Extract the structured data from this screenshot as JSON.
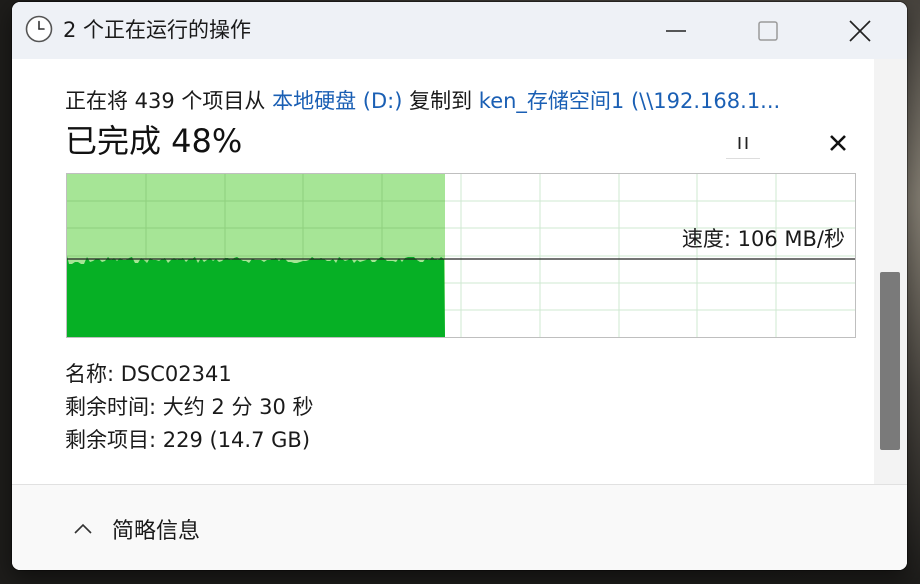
{
  "window": {
    "title": "2 个正在运行的操作"
  },
  "operation": {
    "prefix": "正在将 439 个项目从 ",
    "source": "本地硬盘 (D:)",
    "middle": " 复制到 ",
    "destination": "ken_存储空间1 (\\\\192.168.1...",
    "percent_text": "已完成 48%",
    "progress_fraction": 0.48,
    "speed_text": "速度: 106 MB/秒"
  },
  "details": {
    "name": "名称:  DSC02341",
    "time_left": "剩余时间: 大约 2 分 30 秒",
    "items_left": "剩余项目: 229 (14.7 GB)"
  },
  "footer": {
    "toggle_label": "简略信息"
  },
  "colors": {
    "accent_link": "#1a5fb4",
    "chart_fill": "#06b025",
    "chart_progress_bg": "#a6e596",
    "chart_grid": "#cfe9d2"
  },
  "icons": [
    "clock-icon",
    "minimize-icon",
    "maximize-icon",
    "close-icon",
    "pause-icon",
    "cancel-icon",
    "chevron-up-icon"
  ]
}
